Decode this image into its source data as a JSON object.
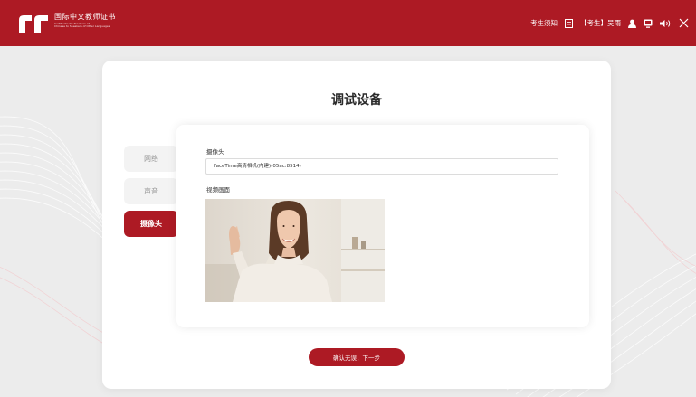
{
  "header": {
    "logo_title": "国际中文教师证书",
    "logo_subtitle_1": "Certificate for Teachers of",
    "logo_subtitle_2": "Chinese to Speakers of Other Languages",
    "exam_notice": "考生须知",
    "user_label": "【考生】吴雨"
  },
  "card": {
    "title": "调试设备"
  },
  "nav": {
    "items": [
      {
        "label": "网络",
        "active": false
      },
      {
        "label": "声音",
        "active": false
      },
      {
        "label": "摄像头",
        "active": true
      }
    ]
  },
  "camera": {
    "label": "摄像头",
    "selected_device": "FaceTime高清相机(内建)(05ac:8514)",
    "preview_label": "视频画面"
  },
  "footer": {
    "next_label": "确认无误，下一步"
  },
  "colors": {
    "brand_red": "#ad1a24",
    "background": "#ececec"
  },
  "icons": [
    "logo-mark-icon",
    "document-icon",
    "user-icon",
    "display-icon",
    "speaker-icon",
    "close-icon"
  ]
}
